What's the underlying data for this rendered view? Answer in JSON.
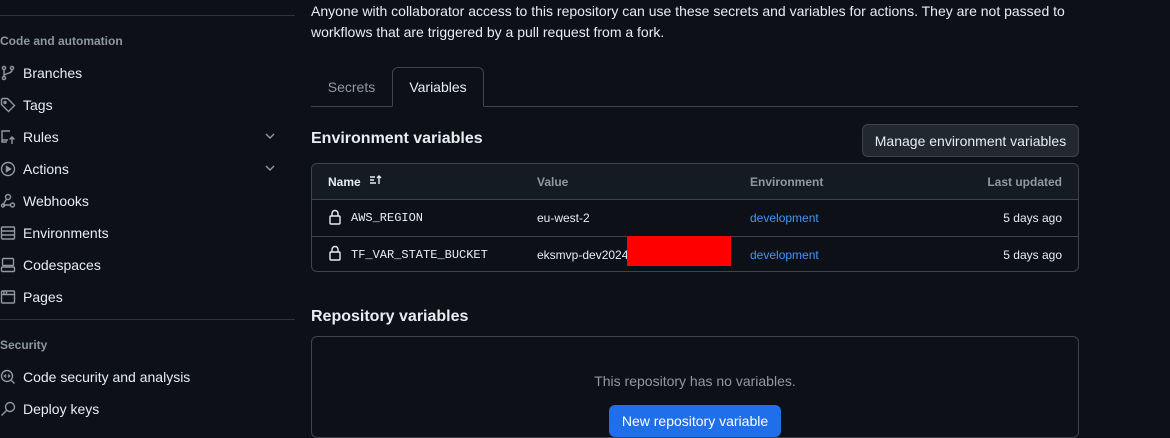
{
  "sidebar": {
    "sections": [
      {
        "title": "Code and automation",
        "items": [
          {
            "label": "Branches",
            "icon": "git-branch-icon"
          },
          {
            "label": "Tags",
            "icon": "tag-icon"
          },
          {
            "label": "Rules",
            "icon": "repo-push-icon",
            "expandable": true
          },
          {
            "label": "Actions",
            "icon": "play-icon",
            "expandable": true
          },
          {
            "label": "Webhooks",
            "icon": "webhook-icon"
          },
          {
            "label": "Environments",
            "icon": "server-icon"
          },
          {
            "label": "Codespaces",
            "icon": "codespaces-icon"
          },
          {
            "label": "Pages",
            "icon": "browser-icon"
          }
        ]
      },
      {
        "title": "Security",
        "items": [
          {
            "label": "Code security and analysis",
            "icon": "codescan-icon"
          },
          {
            "label": "Deploy keys",
            "icon": "key-icon"
          }
        ]
      }
    ]
  },
  "main": {
    "description": "Anyone with collaborator access to this repository can use these secrets and variables for actions. They are not passed to workflows that are triggered by a pull request from a fork.",
    "tabs": [
      {
        "label": "Secrets",
        "active": false
      },
      {
        "label": "Variables",
        "active": true
      }
    ],
    "env_heading": "Environment variables",
    "manage_button": "Manage environment variables",
    "table": {
      "columns": [
        "Name",
        "Value",
        "Environment",
        "Last updated"
      ],
      "rows": [
        {
          "name": "AWS_REGION",
          "value": "eu-west-2",
          "environment": "development",
          "updated": "5 days ago",
          "redacted": false
        },
        {
          "name": "TF_VAR_STATE_BUCKET",
          "value": "eksmvp-dev2024",
          "environment": "development",
          "updated": "5 days ago",
          "redacted": true
        }
      ]
    },
    "repo_heading": "Repository variables",
    "empty_text": "This repository has no variables.",
    "new_button": "New repository variable"
  },
  "colors": {
    "link": "#4493f8",
    "primary": "#1f6feb",
    "redaction": "#ff0000"
  }
}
